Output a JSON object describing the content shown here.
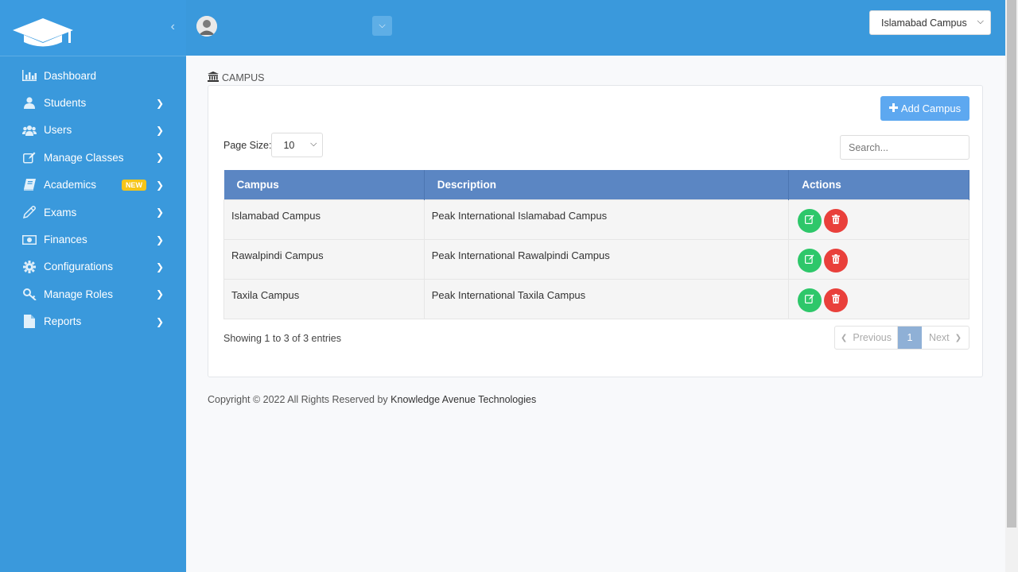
{
  "sidebar": {
    "collapse_glyph": "‹",
    "items": [
      {
        "label": "Dashboard",
        "icon": "bar-chart-icon",
        "has_submenu": false
      },
      {
        "label": "Students",
        "icon": "user-icon",
        "has_submenu": true
      },
      {
        "label": "Users",
        "icon": "users-icon",
        "has_submenu": true
      },
      {
        "label": "Manage Classes",
        "icon": "edit-icon",
        "has_submenu": true
      },
      {
        "label": "Academics",
        "icon": "book-icon",
        "has_submenu": true,
        "badge": "NEW"
      },
      {
        "label": "Exams",
        "icon": "pencil-icon",
        "has_submenu": true
      },
      {
        "label": "Finances",
        "icon": "money-icon",
        "has_submenu": true
      },
      {
        "label": "Configurations",
        "icon": "cog-icon",
        "has_submenu": true
      },
      {
        "label": "Manage Roles",
        "icon": "key-icon",
        "has_submenu": true
      },
      {
        "label": "Reports",
        "icon": "file-icon",
        "has_submenu": true
      }
    ]
  },
  "header": {
    "campus_selected": "Islamabad Campus"
  },
  "page": {
    "title": "CAMPUS",
    "add_button": "Add Campus",
    "page_size_label": "Page Size:",
    "page_size_value": "10",
    "search_placeholder": "Search...",
    "columns": [
      "Campus",
      "Description",
      "Actions"
    ],
    "rows": [
      {
        "campus": "Islamabad Campus",
        "description": "Peak International Islamabad Campus"
      },
      {
        "campus": "Rawalpindi Campus",
        "description": "Peak International Rawalpindi Campus"
      },
      {
        "campus": "Taxila Campus",
        "description": "Peak International Taxila Campus"
      }
    ],
    "showing": "Showing 1 to 3 of 3 entries",
    "pager": {
      "prev": "Previous",
      "current": "1",
      "next": "Next"
    }
  },
  "footer": {
    "text": "Copyright © 2022 All Rights Reserved by ",
    "company": "Knowledge Avenue Technologies"
  },
  "colors": {
    "sidebar": "#3a99dc",
    "table_header": "#5b86c3",
    "edit": "#2ec76a",
    "delete": "#e9403b",
    "add_button": "#5da8f0"
  }
}
